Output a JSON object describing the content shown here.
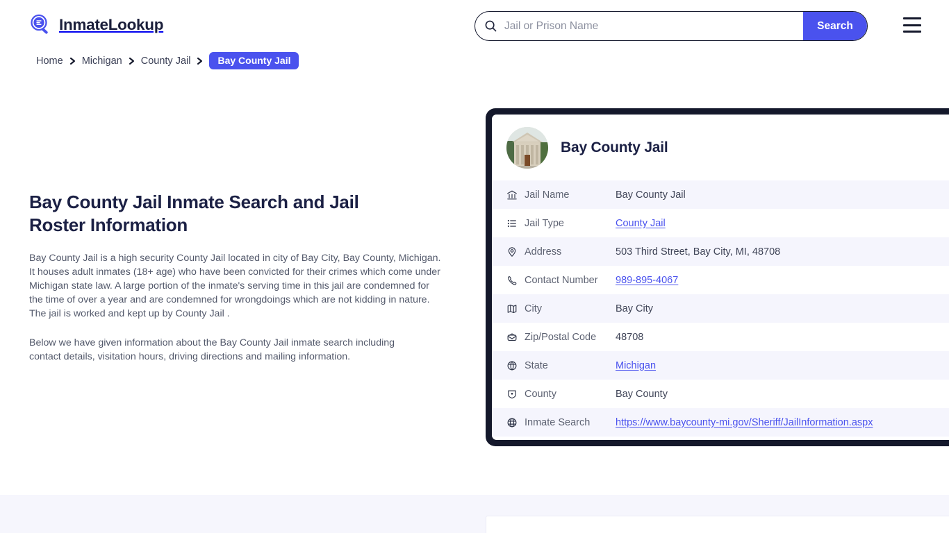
{
  "brand": {
    "name": "InmateLookup",
    "logo_icon": "magnifier-list-icon",
    "accent_color": "#4a52ee",
    "dark_color": "#14182b"
  },
  "search": {
    "placeholder": "Jail or Prison Name",
    "value": "",
    "button_label": "Search",
    "icon": "search-icon"
  },
  "menu": {
    "icon": "hamburger-menu-icon"
  },
  "breadcrumb": {
    "items": [
      {
        "label": "Home"
      },
      {
        "label": "Michigan"
      },
      {
        "label": "County Jail"
      }
    ],
    "current": "Bay County Jail"
  },
  "main": {
    "title": "Bay County Jail Inmate Search and Jail Roster Information",
    "paragraph_1": "Bay County Jail is a high security County Jail located in city of Bay City, Bay County, Michigan. It houses adult inmates (18+ age) who have been convicted for their crimes which come under Michigan state law. A large portion of the inmate's serving time in this jail are condemned for the time of over a year and are condemned for wrongdoings which are not kidding in nature. The jail is worked and kept up by County Jail .",
    "paragraph_2": "Below we have given information about the Bay County Jail inmate search including contact details, visitation hours, driving directions and mailing information."
  },
  "card": {
    "title": "Bay County Jail",
    "photo_alt": "bay-county-courthouse-photo",
    "rows": [
      {
        "icon": "bank-icon",
        "label": "Jail Name",
        "value": "Bay County Jail",
        "link": false
      },
      {
        "icon": "list-icon",
        "label": "Jail Type",
        "value": "County Jail",
        "link": true
      },
      {
        "icon": "map-pin-icon",
        "label": "Address",
        "value": "503 Third Street, Bay City, MI, 48708",
        "link": false
      },
      {
        "icon": "phone-icon",
        "label": "Contact Number",
        "value": "989-895-4067",
        "link": true
      },
      {
        "icon": "map-icon",
        "label": "City",
        "value": "Bay City",
        "link": false
      },
      {
        "icon": "mail-open-icon",
        "label": "Zip/Postal Code",
        "value": "48708",
        "link": false
      },
      {
        "icon": "globe-grid-icon",
        "label": "State",
        "value": "Michigan",
        "link": true
      },
      {
        "icon": "county-badge-icon",
        "label": "County",
        "value": "Bay County",
        "link": false
      },
      {
        "icon": "globe-icon",
        "label": "Inmate Search",
        "value": "https://www.baycounty-mi.gov/Sheriff/JailInformation.aspx",
        "link": true
      }
    ]
  }
}
